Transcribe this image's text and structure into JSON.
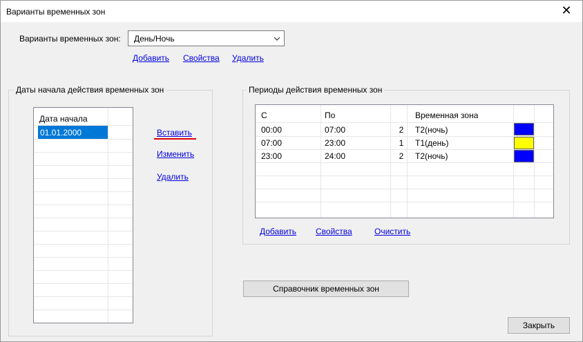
{
  "window": {
    "title": "Варианты временных зон",
    "close_glyph": "✕"
  },
  "variants": {
    "label": "Варианты временных зон:",
    "selected": "День/Ночь",
    "links": {
      "add": "Добавить",
      "properties": "Свойства",
      "delete": "Удалить"
    }
  },
  "dates_group": {
    "legend": "Даты начала действия временных зон",
    "column_header": "Дата начала",
    "rows": [
      "01.01.2000"
    ],
    "actions": {
      "insert": "Вставить",
      "edit": "Изменить",
      "delete": "Удалить"
    }
  },
  "periods_group": {
    "legend": "Периоды действия временных зон",
    "columns": [
      "С",
      "По",
      "",
      "Временная зона",
      ""
    ],
    "rows": [
      {
        "from": "00:00",
        "to": "07:00",
        "num": "2",
        "zone": "T2(ночь)",
        "color": "#0000ff"
      },
      {
        "from": "07:00",
        "to": "23:00",
        "num": "1",
        "zone": "T1(день)",
        "color": "#ffff00"
      },
      {
        "from": "23:00",
        "to": "24:00",
        "num": "2",
        "zone": "T2(ночь)",
        "color": "#0000ff"
      }
    ],
    "actions": {
      "add": "Добавить",
      "properties": "Свойства",
      "clear": "Очистить"
    }
  },
  "buttons": {
    "reference": "Справочник временных зон",
    "close": "Закрыть"
  },
  "colors": {
    "highlight_underline": "#e00000",
    "selection": "#0078d7"
  }
}
